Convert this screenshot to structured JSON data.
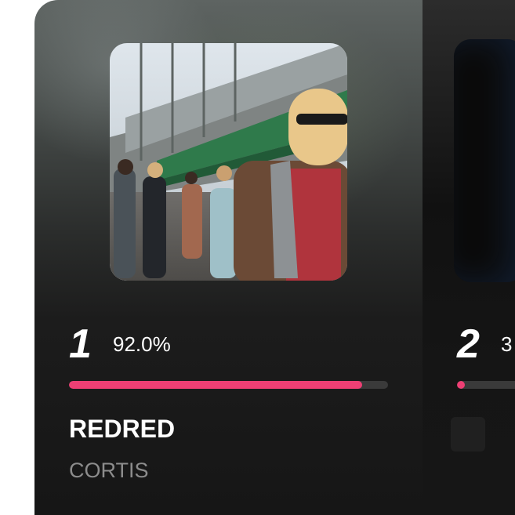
{
  "cards": [
    {
      "rank": "1",
      "percent_text": "92.0%",
      "progress_fraction": 0.92,
      "title": "REDRED",
      "artist": "CORTIS",
      "accent_color": "#ee3f74"
    },
    {
      "rank": "2",
      "percent_text": "3",
      "progress_fraction": 0.03,
      "accent_color": "#ee3f74"
    }
  ]
}
